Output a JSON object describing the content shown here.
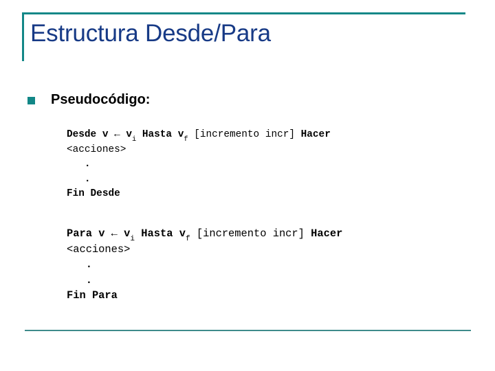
{
  "slide": {
    "title": "Estructura Desde/Para",
    "accent_color": "#128787",
    "title_color": "#173A86",
    "bottom_rule_color": "#3E8B8B",
    "background": "#ffffff"
  },
  "bullet": {
    "marker": "square-bullet",
    "label": "Pseudocódigo:"
  },
  "code_blocks": [
    {
      "id": "desde",
      "lines": [
        {
          "segments": [
            {
              "text": "Desde ",
              "style": "bold"
            },
            {
              "text": "v ",
              "style": "bold"
            },
            {
              "text": "←",
              "style": "arrow"
            },
            {
              "text": " v",
              "style": "bold"
            },
            {
              "text": "i",
              "style": "subscript"
            },
            {
              "text": " Hasta ",
              "style": "bold"
            },
            {
              "text": "v",
              "style": "bold"
            },
            {
              "text": "f",
              "style": "subscript"
            },
            {
              "text": " ",
              "style": "plain"
            },
            {
              "text": "[incremento incr]",
              "style": "plain"
            },
            {
              "text": " Hacer",
              "style": "bold"
            }
          ],
          "plain_text": "Desde v ← vi Hasta vf [incremento incr] Hacer"
        },
        {
          "segments": [
            {
              "text": "<acciones>",
              "style": "plain"
            }
          ],
          "plain_text": "<acciones>"
        },
        {
          "segments": [
            {
              "text": "   .",
              "style": "bold"
            }
          ],
          "plain_text": "   ."
        },
        {
          "segments": [
            {
              "text": "   .",
              "style": "bold"
            }
          ],
          "plain_text": "   ."
        },
        {
          "segments": [
            {
              "text": "Fin Desde",
              "style": "bold"
            }
          ],
          "plain_text": "Fin Desde"
        }
      ]
    },
    {
      "id": "para",
      "lines": [
        {
          "segments": [
            {
              "text": "Para ",
              "style": "bold"
            },
            {
              "text": "v ",
              "style": "bold"
            },
            {
              "text": "←",
              "style": "arrow"
            },
            {
              "text": " v",
              "style": "bold"
            },
            {
              "text": "i",
              "style": "subscript"
            },
            {
              "text": " Hasta ",
              "style": "bold"
            },
            {
              "text": "v",
              "style": "bold"
            },
            {
              "text": "f",
              "style": "subscript"
            },
            {
              "text": " ",
              "style": "plain"
            },
            {
              "text": "[incremento incr]",
              "style": "plain"
            },
            {
              "text": " Hacer",
              "style": "bold"
            }
          ],
          "plain_text": "Para v ← vi Hasta vf [incremento incr] Hacer"
        },
        {
          "segments": [
            {
              "text": "<acciones>",
              "style": "plain"
            }
          ],
          "plain_text": "<acciones>"
        },
        {
          "segments": [
            {
              "text": "   .",
              "style": "bold"
            }
          ],
          "plain_text": "   ."
        },
        {
          "segments": [
            {
              "text": "   .",
              "style": "bold"
            }
          ],
          "plain_text": "   ."
        },
        {
          "segments": [
            {
              "text": "Fin Para",
              "style": "bold"
            }
          ],
          "plain_text": "Fin Para"
        }
      ]
    }
  ]
}
